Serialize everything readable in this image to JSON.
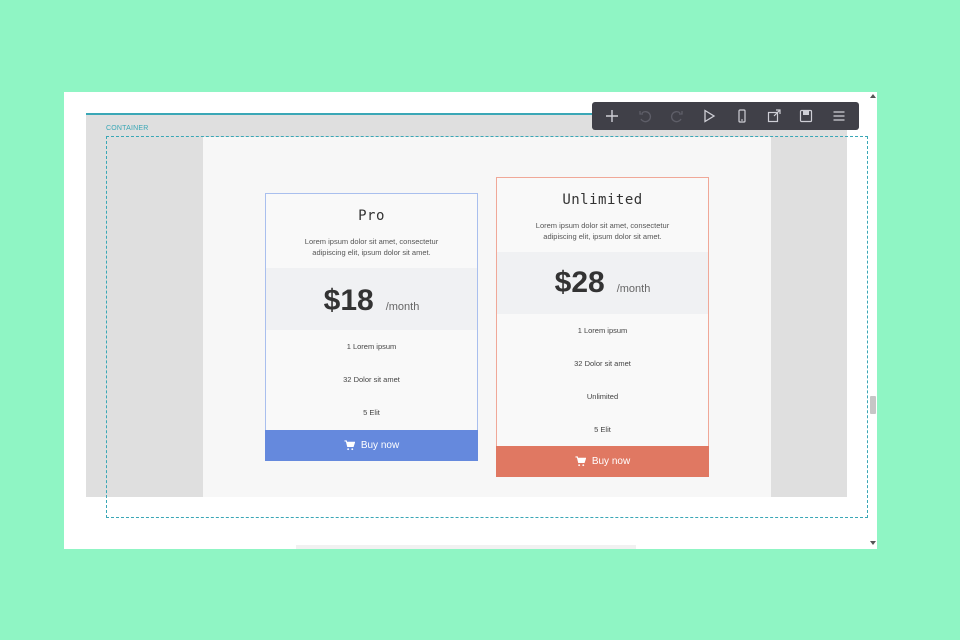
{
  "canvas": {
    "container_label": "CONTAINER"
  },
  "toolbar": {
    "buttons": [
      {
        "icon": "plus-icon",
        "enabled": true
      },
      {
        "icon": "undo-icon",
        "enabled": false
      },
      {
        "icon": "redo-icon",
        "enabled": false
      },
      {
        "icon": "play-icon",
        "enabled": true
      },
      {
        "icon": "mobile-icon",
        "enabled": true
      },
      {
        "icon": "external-link-icon",
        "enabled": true
      },
      {
        "icon": "save-icon",
        "enabled": true
      },
      {
        "icon": "menu-icon",
        "enabled": true
      }
    ]
  },
  "pricing": {
    "pro": {
      "title": "Pro",
      "description": "Lorem ipsum dolor sit amet, consectetur adipiscing elit, ipsum dolor sit amet.",
      "price": "$18",
      "period": "/month",
      "features": [
        "1 Lorem ipsum",
        "32 Dolor sit amet",
        "5 Elit"
      ],
      "button_label": "Buy now",
      "accent": "#6589dd"
    },
    "unlimited": {
      "title": "Unlimited",
      "description": "Lorem ipsum dolor sit amet, consectetur adipiscing elit, ipsum dolor sit amet.",
      "price": "$28",
      "period": "/month",
      "features": [
        "1 Lorem ipsum",
        "32 Dolor sit amet",
        "Unlimited",
        "5 Elit"
      ],
      "button_label": "Buy now",
      "accent": "#e07862"
    }
  },
  "colors": {
    "background": "#8ff5c4",
    "selection": "#3aa7b6",
    "toolbar": "#404048"
  }
}
